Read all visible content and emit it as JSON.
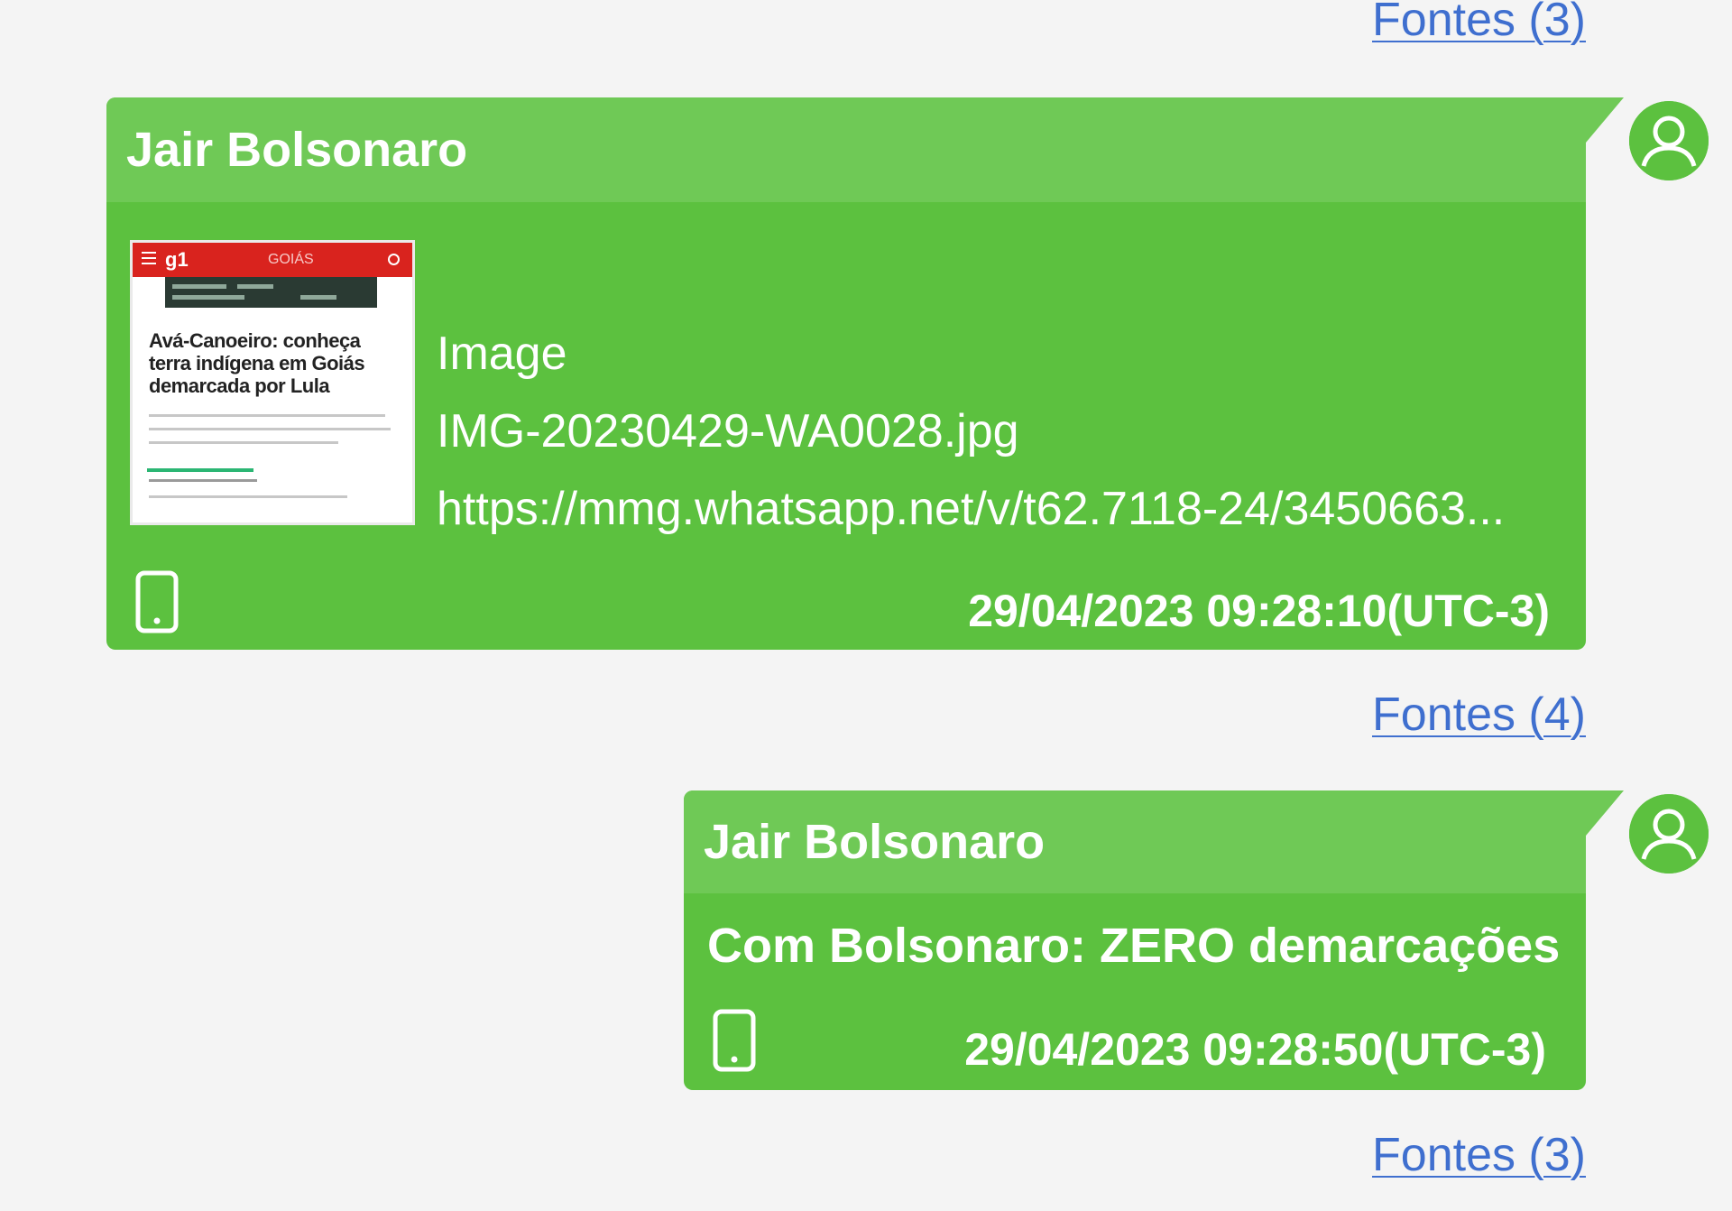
{
  "sources_links": [
    {
      "label": "Fontes (3)"
    },
    {
      "label": "Fontes (4)"
    },
    {
      "label": "Fontes (3)"
    }
  ],
  "messages": [
    {
      "sender": "Jair Bolsonaro",
      "type": "attachment",
      "attachment": {
        "kind": "Image",
        "filename": "IMG-20230429-WA0028.jpg",
        "url": "https://mmg.whatsapp.net/v/t62.7118-24/3450663...",
        "thumbnail": {
          "site": "g1",
          "section": "GOIÁS",
          "headline": "Avá-Canoeiro: conheça terra indígena em Goiás demarcada por Lula"
        }
      },
      "device_icon": "phone-icon",
      "timestamp": "29/04/2023 09:28:10(UTC-3)"
    },
    {
      "sender": "Jair Bolsonaro",
      "type": "text",
      "text": "Com Bolsonaro: ZERO demarcações",
      "device_icon": "phone-icon",
      "timestamp": "29/04/2023 09:28:50(UTC-3)"
    }
  ],
  "colors": {
    "bubble": "#5cc13f",
    "bubble_header": "#6fc956",
    "link": "#3f6fcf",
    "background": "#f4f4f4"
  },
  "avatar_icon": "user-avatar-icon"
}
